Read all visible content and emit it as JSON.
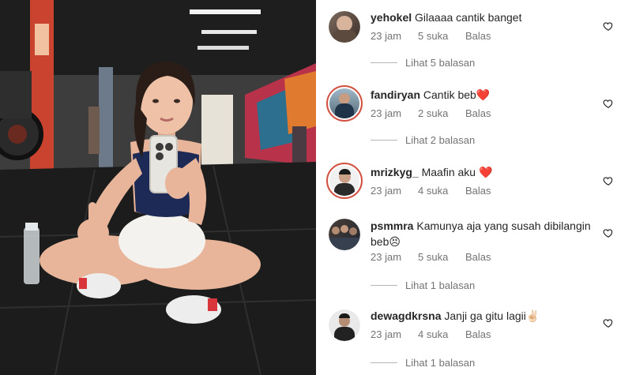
{
  "comments": [
    {
      "username": "yehokel",
      "text": "Gilaaaa cantik banget",
      "time": "23 jam",
      "likes": "5 suka",
      "reply_label": "Balas",
      "view_replies": "Lihat 5 balasan"
    },
    {
      "username": "fandiryan",
      "text": "Cantik beb❤️",
      "time": "23 jam",
      "likes": "2 suka",
      "reply_label": "Balas",
      "view_replies": "Lihat 2 balasan"
    },
    {
      "username": "mrizkyg_",
      "text": "Maafin aku ❤️",
      "time": "23 jam",
      "likes": "4 suka",
      "reply_label": "Balas",
      "view_replies": ""
    },
    {
      "username": "psmmra",
      "text": "Kamunya aja yang susah dibilangin beb😣",
      "time": "23 jam",
      "likes": "5 suka",
      "reply_label": "Balas",
      "view_replies": "Lihat 1 balasan"
    },
    {
      "username": "dewagdkrsna",
      "text": "Janji ga gitu lagii✌🏻",
      "time": "23 jam",
      "likes": "4 suka",
      "reply_label": "Balas",
      "view_replies": "Lihat 1 balasan"
    }
  ],
  "colors": {
    "story_ring": "#d2503f",
    "meta_gray": "#737373",
    "text_dark": "#262626"
  }
}
